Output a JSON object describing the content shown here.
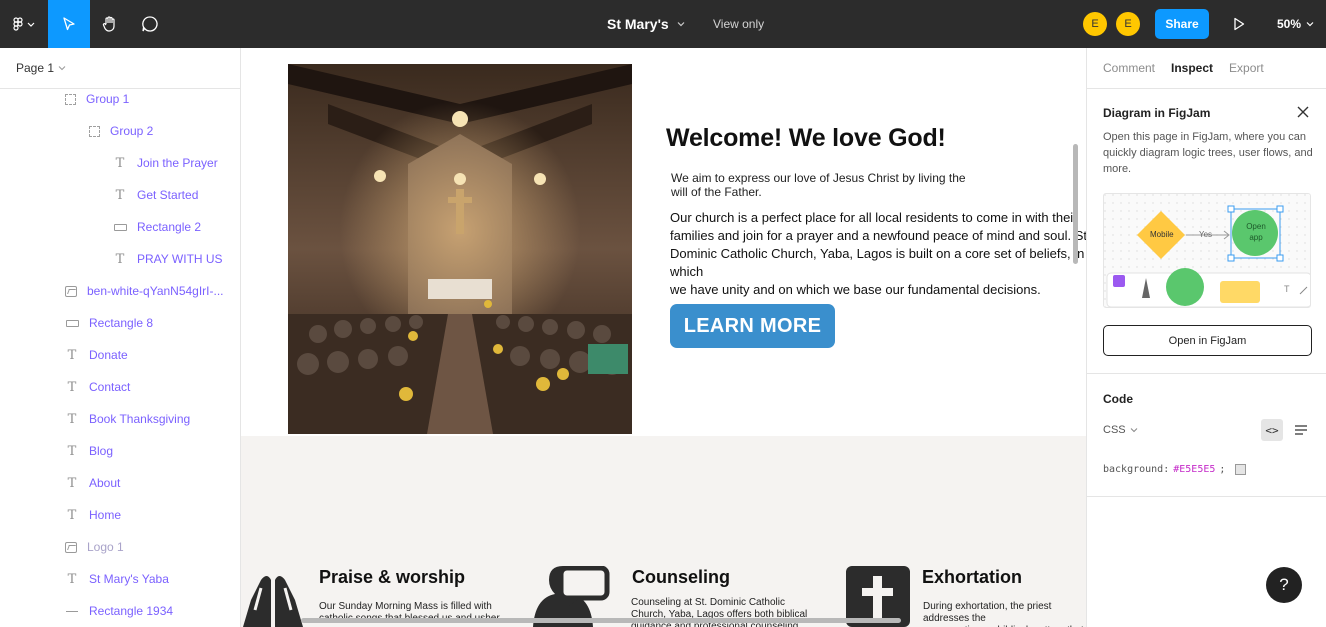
{
  "toolbar": {
    "file_title": "St Mary's",
    "view_mode": "View only",
    "avatars": [
      "E",
      "E"
    ],
    "share_label": "Share",
    "zoom": "50%",
    "tools": [
      "figma-menu-icon",
      "move-icon",
      "hand-icon",
      "comment-icon"
    ]
  },
  "layers": {
    "page": "Page 1",
    "items": [
      {
        "label": "Group 1",
        "icon": "frame-icon"
      },
      {
        "label": "Group 2",
        "icon": "frame-icon"
      },
      {
        "label": "Join the Prayer",
        "icon": "text-icon"
      },
      {
        "label": "Get Started",
        "icon": "text-icon"
      },
      {
        "label": "Rectangle 2",
        "icon": "rectangle-icon"
      },
      {
        "label": "PRAY WITH US",
        "icon": "text-icon"
      },
      {
        "label": "ben-white-qYanN54gIrI-...",
        "icon": "image-icon"
      },
      {
        "label": "Rectangle 8",
        "icon": "rectangle-icon"
      },
      {
        "label": "Donate",
        "icon": "text-icon"
      },
      {
        "label": "Contact",
        "icon": "text-icon"
      },
      {
        "label": "Book Thanksgiving",
        "icon": "text-icon"
      },
      {
        "label": "Blog",
        "icon": "text-icon"
      },
      {
        "label": "About",
        "icon": "text-icon"
      },
      {
        "label": "Home",
        "icon": "text-icon"
      },
      {
        "label": "Logo 1",
        "icon": "image-icon"
      },
      {
        "label": "St Mary's Yaba",
        "icon": "text-icon"
      },
      {
        "label": "Rectangle 1934",
        "icon": "line-icon"
      }
    ]
  },
  "canvas": {
    "heading": "Welcome! We love God!",
    "aim_text": "We aim to express our love of Jesus Christ by living the will of the Father.",
    "church_text": "Our church is a perfect place for all local residents to come in with their\nfamilies and join for a prayer and a newfound peace of mind and soul. St.\nDominic Catholic Church, Yaba, Lagos is built on a core set of beliefs, in which\nwe have unity and on which we base our fundamental decisions.",
    "cta": "LEARN MORE",
    "services": [
      {
        "title": "Praise & worship",
        "text": "Our Sunday Morning Mass is filled with\ncatholic songs that blessed us and usher",
        "icon": "praying-hands-icon"
      },
      {
        "title": "Counseling",
        "text": "Counseling at St. Dominic Catholic\nChurch, Yaba, Lagos offers both biblical\nguidance and professional counseling",
        "icon": "counseling-icon"
      },
      {
        "title": "Exhortation",
        "text": "During exhortation, the priest addresses the\ncongregation on biblical matters that",
        "icon": "cross-icon"
      }
    ],
    "background": "#E5E5E5"
  },
  "inspect": {
    "tabs": [
      "Comment",
      "Inspect",
      "Export"
    ],
    "active_tab": "Inspect",
    "figjam": {
      "title": "Diagram in FigJam",
      "description": "Open this page in FigJam, where you can quickly diagram logic trees, user flows, and more.",
      "preview_mobile": "Mobile",
      "preview_yes": "Yes",
      "preview_open_app": "Open app",
      "button": "Open in FigJam"
    },
    "code": {
      "heading": "Code",
      "language": "CSS",
      "property": "background:",
      "value": "#E5E5E5",
      "semicolon": ";"
    }
  },
  "help_label": "?",
  "colors": {
    "toolbar_bg": "#2c2c2c",
    "accent": "#0d99ff",
    "layer_text": "#7b61ff",
    "cta": "#3a8fcd",
    "avatar": "#ffc700"
  }
}
